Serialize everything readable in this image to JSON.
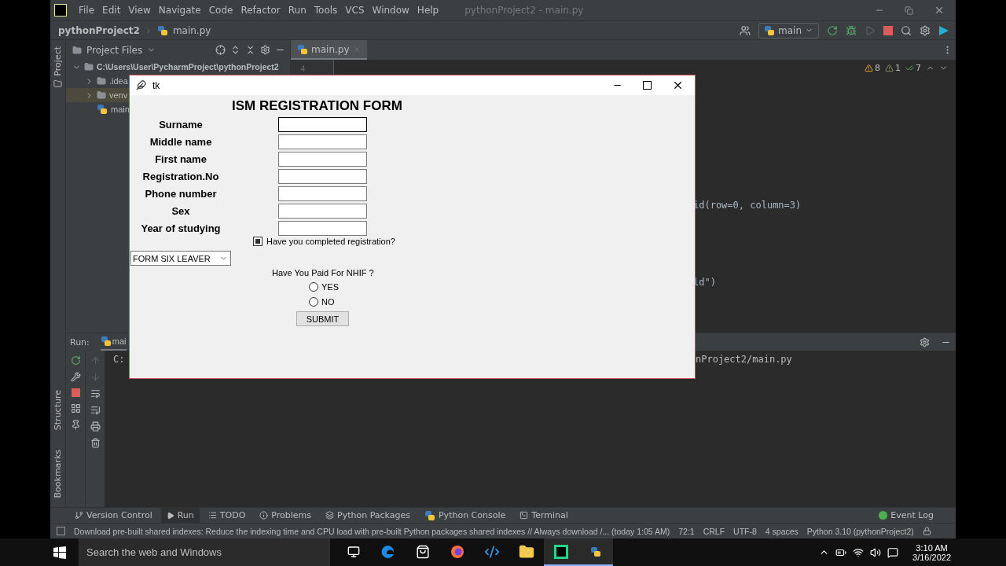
{
  "ide": {
    "menu": [
      "File",
      "Edit",
      "View",
      "Navigate",
      "Code",
      "Refactor",
      "Run",
      "Tools",
      "VCS",
      "Window",
      "Help"
    ],
    "window_title": "pythonProject2 - main.py",
    "breadcrumb": [
      "pythonProject2",
      "main.py"
    ],
    "run_config": "main",
    "side_tabs": {
      "top": "Project",
      "bottom": [
        "Structure",
        "Bookmarks"
      ]
    },
    "project_panel": {
      "title": "Project Files",
      "tree": [
        {
          "label": "C:\\Users\\User\\PycharmProject\\pythonProject2",
          "kind": "folder",
          "expanded": true,
          "selected": false,
          "children": [
            {
              "label": ".idea",
              "kind": "folder",
              "expanded": false,
              "selected": false
            },
            {
              "label": "venv",
              "kind": "folder",
              "expanded": false,
              "selected": true
            },
            {
              "label": "main",
              "kind": "file",
              "selected": false
            }
          ]
        }
      ]
    },
    "editor": {
      "tab": "main.py",
      "line_number": "4",
      "code_lines": [
        "id(row=0, column=3)",
        "ld\")"
      ],
      "inspections": [
        {
          "kind": "warning",
          "count": "8"
        },
        {
          "kind": "weak",
          "count": "1"
        },
        {
          "kind": "typo",
          "count": "7"
        }
      ]
    },
    "run_panel": {
      "label": "Run:",
      "tab": "mai",
      "console": [
        "C:",
        "nProject2/main.py"
      ]
    },
    "tool_tabs": [
      {
        "label": "Version Control",
        "kind": "vcs",
        "selected": false
      },
      {
        "label": "Run",
        "kind": "run",
        "selected": true
      },
      {
        "label": "TODO",
        "kind": "todo",
        "selected": false
      },
      {
        "label": "Problems",
        "kind": "problems",
        "selected": false
      },
      {
        "label": "Python Packages",
        "kind": "packages",
        "selected": false
      },
      {
        "label": "Python Console",
        "kind": "console",
        "selected": false
      },
      {
        "label": "Terminal",
        "kind": "terminal",
        "selected": false
      }
    ],
    "event_log": "Event Log",
    "status_bar": {
      "message": "Download pre-built shared indexes: Reduce the indexing time and CPU load with pre-built Python packages shared indexes // Always download /... (today 1:05 AM)",
      "items": [
        "72:1",
        "CRLF",
        "UTF-8",
        "4 spaces",
        "Python 3.10 (pythonProject2)"
      ]
    }
  },
  "tk_window": {
    "title": "tk",
    "heading": "ISM REGISTRATION FORM",
    "fields": [
      {
        "label": "Surname",
        "focused": true
      },
      {
        "label": "Middle name",
        "focused": false
      },
      {
        "label": "First name",
        "focused": false
      },
      {
        "label": "Registration.No",
        "focused": false
      },
      {
        "label": "Phone number",
        "focused": false
      },
      {
        "label": "Sex",
        "focused": false
      },
      {
        "label": "Year of studying",
        "focused": false
      }
    ],
    "checkbox": {
      "label": "Have you completed registration?",
      "checked": true
    },
    "dropdown": {
      "value": "FORM SIX LEAVER"
    },
    "question": "Have You Paid For NHIF ?",
    "radios": [
      {
        "label": "YES",
        "selected": false
      },
      {
        "label": "NO",
        "selected": false
      }
    ],
    "submit": "SUBMIT"
  },
  "taskbar": {
    "search": {
      "placeholder": "Search the web and Windows"
    },
    "apps": [
      {
        "kind": "taskview",
        "active": false
      },
      {
        "kind": "edge",
        "active": false
      },
      {
        "kind": "store",
        "active": false
      },
      {
        "kind": "firefox",
        "active": false
      },
      {
        "kind": "vscode",
        "active": false
      },
      {
        "kind": "explorer",
        "active": false
      },
      {
        "kind": "pycharm",
        "active": true
      },
      {
        "kind": "python",
        "active": true
      }
    ],
    "time": "3:10 AM",
    "date": "3/16/2022"
  }
}
